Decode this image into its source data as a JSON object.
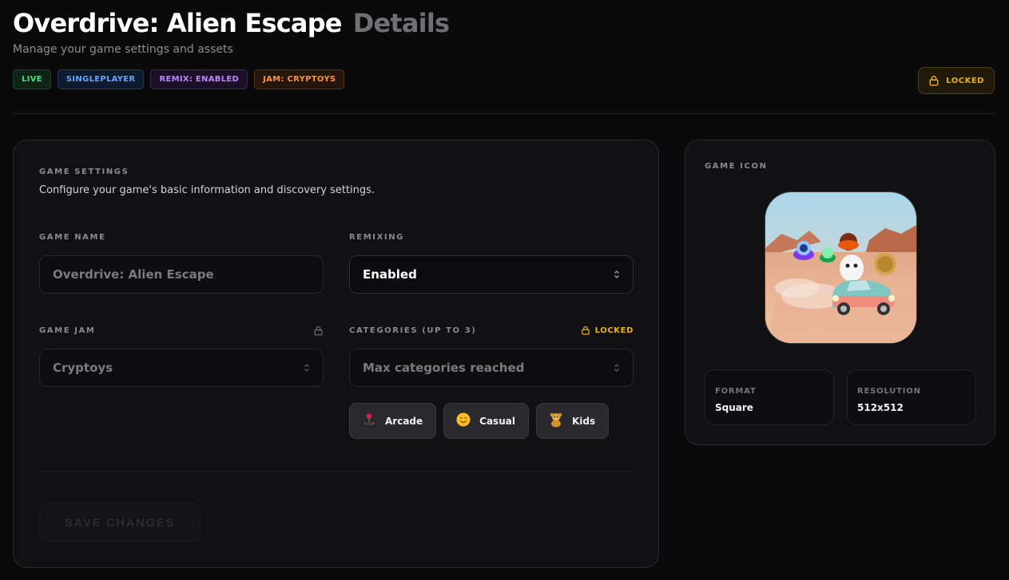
{
  "header": {
    "title": "Overdrive: Alien Escape",
    "title_suffix": "Details",
    "subtitle": "Manage your game settings and assets",
    "badges": [
      {
        "label": "LIVE",
        "color": "#4ade80"
      },
      {
        "label": "SINGLEPLAYER",
        "color": "#60a5fa"
      },
      {
        "label": "REMIX: ENABLED",
        "color": "#c084fc"
      },
      {
        "label": "JAM: CRYPTOYS",
        "color": "#fb923c"
      }
    ],
    "status_pill": {
      "label": "LOCKED",
      "icon": "lock-icon",
      "color": "#eab308"
    }
  },
  "settings": {
    "section_title": "GAME SETTINGS",
    "description": "Configure your game's basic information and discovery settings.",
    "game_name": {
      "label": "GAME NAME",
      "value": "Overdrive: Alien Escape"
    },
    "remixing": {
      "label": "REMIXING",
      "value": "Enabled"
    },
    "game_jam": {
      "label": "GAME JAM",
      "value": "Cryptoys",
      "icon": "lock-icon"
    },
    "categories": {
      "label": "CATEGORIES (UP TO 3)",
      "locked_label": "LOCKED",
      "placeholder": "Max categories reached",
      "selected": [
        {
          "label": "Arcade",
          "icon": "joystick-icon"
        },
        {
          "label": "Casual",
          "icon": "smile-icon"
        },
        {
          "label": "Kids",
          "icon": "teddy-bear-icon"
        }
      ]
    },
    "save_label": "SAVE CHANGES"
  },
  "icon_panel": {
    "title": "GAME ICON",
    "format": {
      "label": "FORMAT",
      "value": "Square"
    },
    "resolution": {
      "label": "RESOLUTION",
      "value": "512x512"
    }
  }
}
